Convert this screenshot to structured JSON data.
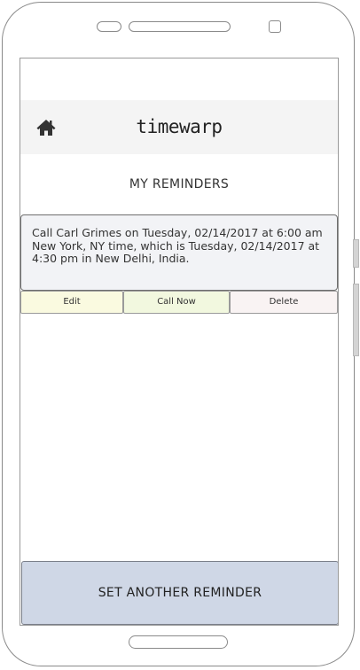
{
  "header": {
    "app_title": "timewarp",
    "home_icon": "home-icon"
  },
  "main": {
    "section_title": "MY REMINDERS",
    "reminders": [
      {
        "text": "Call Carl Grimes on Tuesday, 02/14/2017 at 6:00 am New York, NY time, which is Tuesday, 02/14/2017 at 4:30 pm in New Delhi, India.",
        "actions": {
          "edit": "Edit",
          "call_now": "Call Now",
          "delete": "Delete"
        }
      }
    ]
  },
  "footer": {
    "set_reminder_label": "SET ANOTHER REMINDER"
  },
  "colors": {
    "header_bg": "#f4f4f4",
    "card_bg": "#f2f3f6",
    "edit_bg": "#fafae0",
    "call_now_bg": "#f2f8df",
    "delete_bg": "#f9f3f3",
    "cta_bg": "#cfd7e6"
  }
}
